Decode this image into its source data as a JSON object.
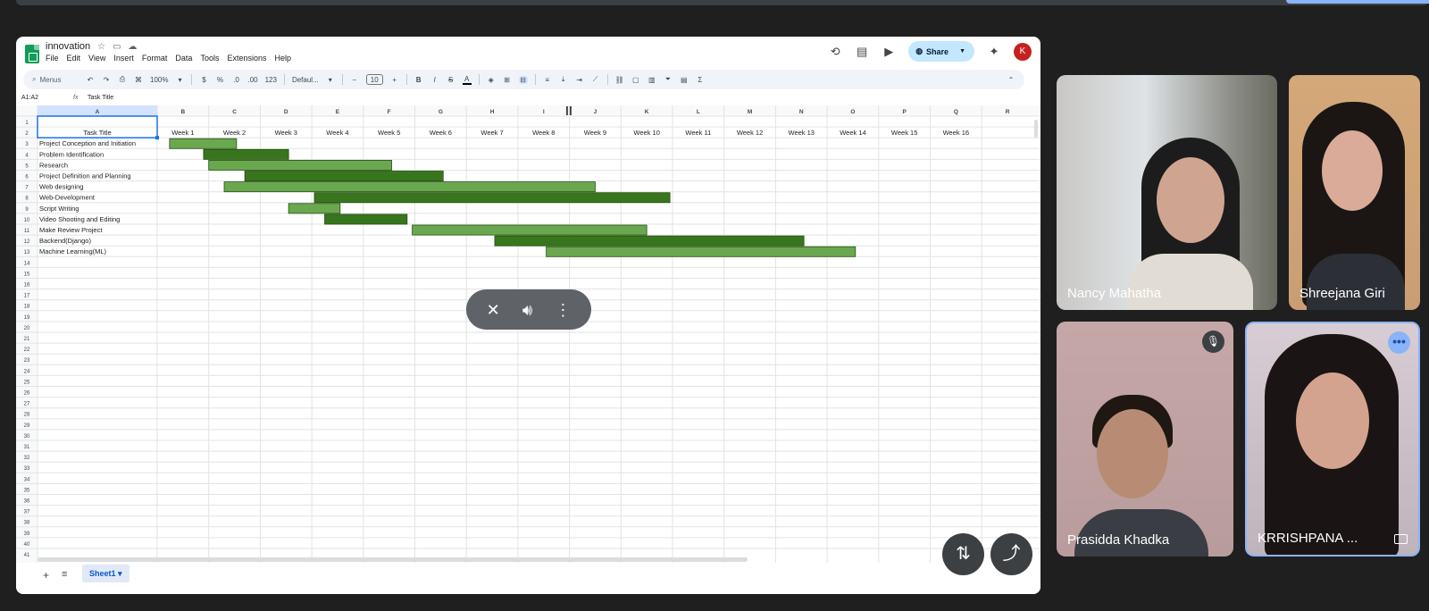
{
  "sheets": {
    "doc_title": "innovation",
    "title_icons": [
      "star-icon",
      "folder-icon",
      "cloud-icon"
    ],
    "menu": [
      "File",
      "Edit",
      "View",
      "Insert",
      "Format",
      "Data",
      "Tools",
      "Extensions",
      "Help"
    ],
    "share_label": "Share",
    "avatar_letter": "K",
    "toolbar": {
      "search_label": "Menus",
      "zoom": "100%",
      "currency": "$",
      "percent": "%",
      "dec_decrease": ".0",
      "dec_increase": ".00",
      "number_format": "123",
      "font": "Defaul...",
      "font_size": "10",
      "bold": "B",
      "italic": "I",
      "strike": "S",
      "text_color": "A"
    },
    "name_box": "A1:A2",
    "fx_label": "fx",
    "formula_value": "Task Title",
    "sheet_tab": "Sheet1",
    "columns": [
      "A",
      "B",
      "C",
      "D",
      "E",
      "F",
      "G",
      "H",
      "I",
      "J",
      "K",
      "L",
      "M",
      "N",
      "O",
      "P",
      "Q",
      "R"
    ],
    "rows": [
      "1",
      "2",
      "3",
      "4",
      "5",
      "6",
      "7",
      "8",
      "9",
      "10",
      "11",
      "12",
      "13",
      "14",
      "15",
      "16",
      "17",
      "18",
      "19",
      "20",
      "21",
      "22",
      "23",
      "24",
      "25",
      "26",
      "27",
      "28",
      "29",
      "30",
      "31",
      "32",
      "33",
      "34",
      "35",
      "36",
      "37",
      "38",
      "39",
      "40",
      "41"
    ],
    "header_label": "Task Title",
    "weeks": [
      "Week 1",
      "Week 2",
      "Week 3",
      "Week 4",
      "Week 5",
      "Week 6",
      "Week 7",
      "Week 8",
      "Week 9",
      "Week 10",
      "Week 11",
      "Week 12",
      "Week 13",
      "Week 14",
      "Week 15",
      "Week 16"
    ],
    "tasks": [
      {
        "title": "Project Conception and Initiation",
        "start": 1.24,
        "end": 2.54,
        "shade": "light"
      },
      {
        "title": "Problem Identification",
        "start": 1.9,
        "end": 3.55,
        "shade": "dark"
      },
      {
        "title": "Research",
        "start": 2.0,
        "end": 5.55,
        "shade": "light"
      },
      {
        "title": "Project Definition and Planning",
        "start": 2.7,
        "end": 6.55,
        "shade": "dark"
      },
      {
        "title": "Web designing",
        "start": 2.3,
        "end": 9.5,
        "shade": "light"
      },
      {
        "title": "Web-Development",
        "start": 4.05,
        "end": 10.95,
        "shade": "dark"
      },
      {
        "title": "Script Writing",
        "start": 3.55,
        "end": 4.55,
        "shade": "light"
      },
      {
        "title": "Video Shooting and Editing",
        "start": 4.25,
        "end": 5.85,
        "shade": "dark"
      },
      {
        "title": "Make Review Project",
        "start": 5.95,
        "end": 10.5,
        "shade": "light"
      },
      {
        "title": "Backend(Django)",
        "start": 7.55,
        "end": 13.55,
        "shade": "dark"
      },
      {
        "title": "Machine Learning(ML)",
        "start": 8.55,
        "end": 14.55,
        "shade": "light"
      }
    ],
    "colors": {
      "light": "#6aa84f",
      "dark": "#38761d",
      "bar_border": "#274e13",
      "selection": "#1a73e8"
    }
  },
  "call_controls": [
    "unpin-icon",
    "volume-icon",
    "more-vert-icon"
  ],
  "fabs": [
    "move-tile-icon",
    "share-icon"
  ],
  "participants": [
    {
      "name": "Nancy Mahatha",
      "muted": false
    },
    {
      "name": "Shreejana Giri",
      "muted": false
    },
    {
      "name": "Prasidda Khadka",
      "muted": true
    },
    {
      "name": "KRRISHPANA ...",
      "muted": false,
      "self": true
    }
  ]
}
